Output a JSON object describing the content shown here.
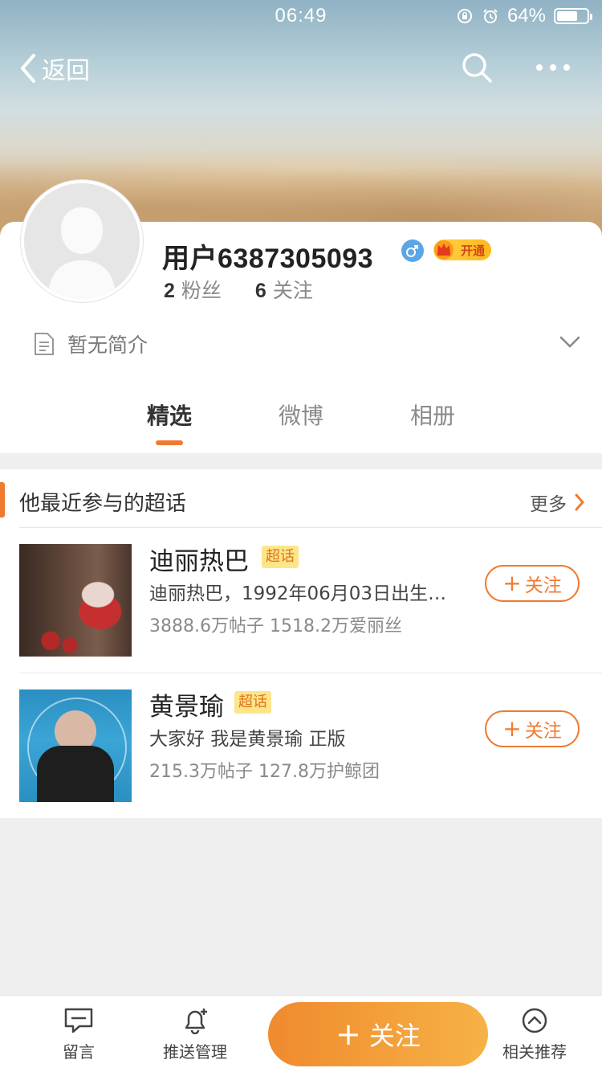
{
  "status_bar": {
    "time": "06:49",
    "battery_percent": "64%"
  },
  "nav": {
    "back_label": "返回"
  },
  "profile": {
    "username": "用户6387305093",
    "vip_label": "开通",
    "fans_count": "2",
    "fans_label": "粉丝",
    "following_count": "6",
    "following_label": "关注",
    "intro": "暂无简介"
  },
  "tabs": [
    {
      "label": "精选"
    },
    {
      "label": "微博"
    },
    {
      "label": "相册"
    }
  ],
  "section": {
    "title": "他最近参与的超话",
    "more_label": "更多"
  },
  "topics": [
    {
      "name": "迪丽热巴",
      "badge": "超话",
      "desc": "迪丽热巴，1992年06月03日出生…",
      "meta": "3888.6万帖子 1518.2万爱丽丝",
      "follow_label": "关注"
    },
    {
      "name": "黄景瑜",
      "badge": "超话",
      "desc": "大家好 我是黄景瑜 正版",
      "meta": "215.3万帖子 127.8万护鲸团",
      "follow_label": "关注"
    }
  ],
  "bottom_bar": {
    "message_label": "留言",
    "push_label": "推送管理",
    "follow_label": "关注",
    "recommend_label": "相关推荐"
  },
  "colors": {
    "accent": "#f07a2f",
    "badge_bg": "#fde58a"
  }
}
